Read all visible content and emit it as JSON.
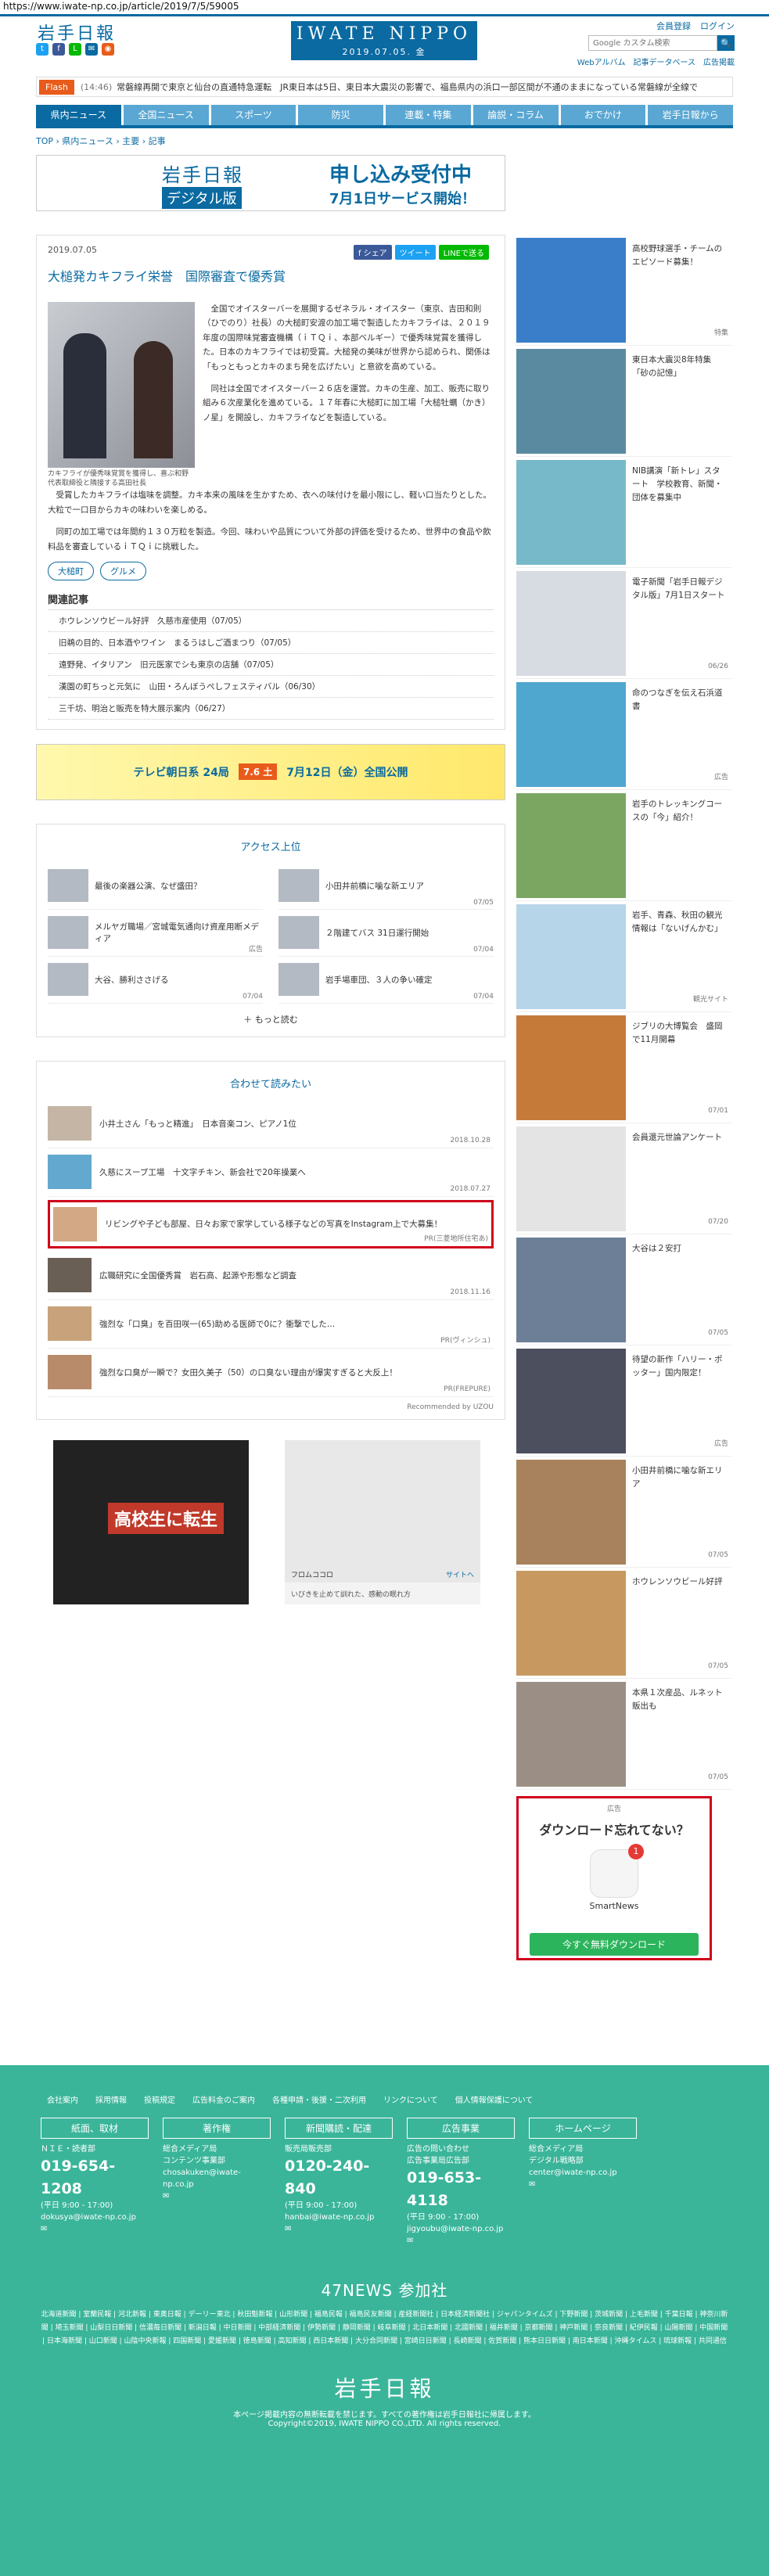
{
  "url": "https://www.iwate-np.co.jp/article/2019/7/5/59005",
  "header": {
    "logo": "岩手日報",
    "masthead": "IWATE NIPPO",
    "date": "2019.07.05. 金",
    "links": [
      "会員登録",
      "ログイン"
    ],
    "search_placeholder": "Google カスタム検索",
    "search_button": "🔍",
    "sub_links": [
      "Webアルバム",
      "記事データベース",
      "広告掲載"
    ]
  },
  "flash": {
    "label": "Flash",
    "time": "(14:46)",
    "text": "常磐線再開で東京と仙台の直通特急運転　JR東日本は5日、東日本大震災の影響で、福島県内の浜口一部区間が不通のままになっている常磐線が全線で"
  },
  "nav": [
    "県内ニュース",
    "全国ニュース",
    "スポーツ",
    "防災",
    "連載・特集",
    "論説・コラム",
    "おでかけ",
    "岩手日報から"
  ],
  "breadcrumb": "TOP › 県内ニュース › 主要 › 記事",
  "banner": {
    "logo": "岩手日報",
    "sub": "デジタル版",
    "h1": "申し込み受付中",
    "h2": "7月1日サービス開始！"
  },
  "article": {
    "date": "2019.07.05",
    "share": [
      "f シェア",
      "ツイート",
      "LINEで送る"
    ],
    "title": "大槌発カキフライ栄誉　国際審査で優秀賞",
    "caption": "カキフライが優秀味覚賞を獲得し、喜ぶ和野代表取締役と隣接する高田社長",
    "paras": [
      "全国でオイスターバーを展開するゼネラル・オイスター（東京、吉田和則（ひでのり）社長）の大槌町安渡の加工場で製造したカキフライは、２０１９年度の国際味覚審査機構（ｉＴＱｉ、本部ベルギー）で優秀味覚賞を獲得した。日本のカキフライでは初受賞。大槌発の美味が世界から認められ、関係は「もっともっとカキのまち発を広げたい」と意欲を高めている。",
      "同社は全国でオイスターバー２６店を運営。カキの生産、加工、販売に取り組み６次産業化を進めている。１７年春に大槌町に加工場「大槌牡蠣（かき）ノ星」を開設し、カキフライなどを製造している。",
      "受賞したカキフライは塩味を調整。カキ本来の風味を生かすため、衣への味付けを最小限にし、軽い口当たりとした。大粒で一口目からカキの味わいを楽しめる。",
      "同町の加工場では年間約１３０万粒を製造。今回、味わいや品質について外部の評価を受けるため、世界中の食品や飲料品を審査しているｉＴＱｉに挑戦した。"
    ],
    "tags": [
      "大槌町",
      "グルメ"
    ],
    "related_heading": "関連記事",
    "related": [
      "ホウレンソウビール好評　久慈市産使用（07/05）",
      "旧鵜の目的、日本酒やワイン　まるうはしご酒まつり（07/05）",
      "遠野発、イタリアン　旧元医家でシも東京の店舗（07/05）",
      "漢園の町ちっと元気に　山田・ろんぼうぺしフェスティバル（06/30）",
      "三千坊、明治と販売を特大展示案内（06/27）"
    ]
  },
  "ad_strip": {
    "left": "テレビ朝日系 24局",
    "mid": "7.6 土",
    "right": "7月12日（金）全国公開"
  },
  "ranking": {
    "title": "アクセス上位",
    "items": [
      {
        "title": "最後の楽器公演、なぜ盛田？",
        "date": ""
      },
      {
        "title": "小田井前橋に噛な新エリア",
        "date": "07/05"
      },
      {
        "title": "メルヤガ職場／宮城電気通向け資産用断メディア",
        "date": "広告"
      },
      {
        "title": "２階建てバス 31日運行開始",
        "date": "07/04"
      },
      {
        "title": "大谷、勝利ささげる",
        "date": "07/04"
      },
      {
        "title": "岩手場車団、３人の争い確定",
        "date": "07/04"
      }
    ],
    "more": "＋ もっと読む"
  },
  "recommend": {
    "title": "合わせて読みたい",
    "items": [
      {
        "title": "小井土さん「もっと精進」　日本音楽コン、ピアノ1位",
        "date": "2018.10.28"
      },
      {
        "title": "久慈にスーブ工場　十文字チキン、新会社で20年操業へ",
        "date": "2018.07.27"
      },
      {
        "title": "リビングや子ども部屋、日々お家で家学している様子などの写真をInstagram上で大募集！",
        "date": "PR(三菱地所住宅あ)"
      },
      {
        "title": "広職研究に全国優秀賞　岩石高、起源や形態など調査",
        "date": "2018.11.16"
      },
      {
        "title": "強烈な「口臭」を百田咲一(65)助める医師で0に？衝撃でした…",
        "date": "PR(ヴィンシュ)"
      },
      {
        "title": "強烈な口臭が一瞬で？女田久美子（50）の口臭ない理由が爆実すぎると大反上！",
        "date": "PR(FREPURE)"
      }
    ],
    "footnote": "Recommended by UZOU"
  },
  "bottom_ads": {
    "left": "高校生に転生",
    "right_caption": "いびきを止めて訓れた、感動の眠れ方",
    "right_brand": "フロムココロ",
    "right_link": "サイトへ"
  },
  "sidebar": [
    {
      "title": "高校野球選手・チームのエピソード募集！",
      "meta": "特集",
      "color": "#3a7ec9"
    },
    {
      "title": "東日本大震災8年特集「砂の記憶」",
      "meta": "",
      "color": "#5a8aa0"
    },
    {
      "title": "NIB講演「新トレ」スタート　学校教育、新聞・団体を募集中",
      "meta": "",
      "color": "#78b9c9"
    },
    {
      "title": "電子新聞「岩手日報デジタル版」7月1日スタート",
      "meta": "06/26",
      "color": "#d7dbe2"
    },
    {
      "title": "命のつなぎを伝え石浜道書",
      "meta": "広告",
      "color": "#4fa6cf"
    },
    {
      "title": "岩手のトレッキングコースの「今」紹介！",
      "meta": "",
      "color": "#7aa662"
    },
    {
      "title": "岩手、青森、秋田の観光情報は「ないげんかむ」",
      "meta": "観光サイト",
      "color": "#b7d5e8"
    },
    {
      "title": "ジブリの大博覧会　盛岡で11月開幕",
      "meta": "07/01",
      "color": "#c67a3a"
    },
    {
      "title": "会員還元世論アンケート",
      "meta": "07/20",
      "color": "#e4e4e4"
    },
    {
      "title": "大谷は２安打",
      "meta": "07/05",
      "color": "#6c7f96"
    },
    {
      "title": "待望の新作「ハリー・ポッター」国内限定！",
      "meta": "広告",
      "color": "#4b4f5e"
    },
    {
      "title": "小田井前橋に噛な新エリア",
      "meta": "07/05",
      "color": "#a7825c"
    },
    {
      "title": "ホウレンソウビール好評",
      "meta": "07/05",
      "color": "#c79860"
    },
    {
      "title": "本県１次産品、ルネット販出も",
      "meta": "07/05",
      "color": "#9b8f85"
    }
  ],
  "smartnews": {
    "title": "ダウンロード忘れてない？",
    "app": "SmartNews",
    "badge": "1",
    "button": "今すぐ無料ダウンロード",
    "ad": "広告"
  },
  "footer": {
    "links": [
      "会社案内",
      "採用情報",
      "投稿規定",
      "広告料金のご案内",
      "各種申請・後援・二次利用",
      "リンクについて",
      "個人情報保護について"
    ],
    "cols": [
      {
        "head": "紙面、取材",
        "lines": [
          "ＮＩＥ・読者部"
        ],
        "phone": "019-654-1208",
        "hours": "(平日 9:00 - 17:00)",
        "mail": "dokusya@iwate-np.co.jp"
      },
      {
        "head": "著作権",
        "lines": [
          "総合メディア局",
          "コンテンツ事業部"
        ],
        "phone": "",
        "hours": "",
        "mail": "chosakuken@iwate-np.co.jp"
      },
      {
        "head": "新聞購読・配達",
        "lines": [
          "販売局販売部"
        ],
        "phone": "0120-240-840",
        "hours": "(平日 9:00 - 17:00)",
        "mail": "hanbai@iwate-np.co.jp"
      },
      {
        "head": "広告事業",
        "lines": [
          "広告の問い合わせ",
          "広告事業局広告部"
        ],
        "phone": "019-653-4118",
        "hours": "(平日 9:00 - 17:00)",
        "mail": "jigyoubu@iwate-np.co.jp"
      },
      {
        "head": "ホームページ",
        "lines": [
          "総合メディア局",
          "デジタル戦略部"
        ],
        "phone": "",
        "hours": "",
        "mail": "center@iwate-np.co.jp"
      }
    ],
    "n47_title": "47NEWS 参加社",
    "n47": "北海道新聞 | 室蘭民報 | 河北新報 | 東奥日報 | デーリー東北 | 秋田魁新報 | 山形新聞 | 福島民報 | 福島民友新聞 | 産経新聞社 | 日本経済新聞社 | ジャパンタイムズ | 下野新聞 | 茨城新聞 | 上毛新聞 | 千葉日報 | 神奈川新聞 | 埼玉新聞 | 山梨日日新聞 | 信濃毎日新聞 | 新潟日報 | 中日新聞 | 中部経済新聞 | 伊勢新聞 | 静岡新聞 | 岐阜新聞 | 北日本新聞 | 北國新聞 | 福井新聞 | 京都新聞 | 神戸新聞 | 奈良新聞 | 紀伊民報 | 山陽新聞 | 中国新聞 | 日本海新聞 | 山口新聞 | 山陰中央新報 | 四国新聞 | 愛媛新聞 | 徳島新聞 | 高知新聞 | 西日本新聞 | 大分合同新聞 | 宮崎日日新聞 | 長崎新聞 | 佐賀新聞 | 熊本日日新聞 | 南日本新聞 | 沖縄タイムス | 琉球新報 | 共同通信",
    "logo": "岩手日報",
    "copy1": "本ページ掲載内容の無断転載を禁じます。すべての著作権は岩手日報社に帰属します。",
    "copy2": "Copyright©2019, IWATE NIPPO CO.,LTD. All rights reserved."
  }
}
